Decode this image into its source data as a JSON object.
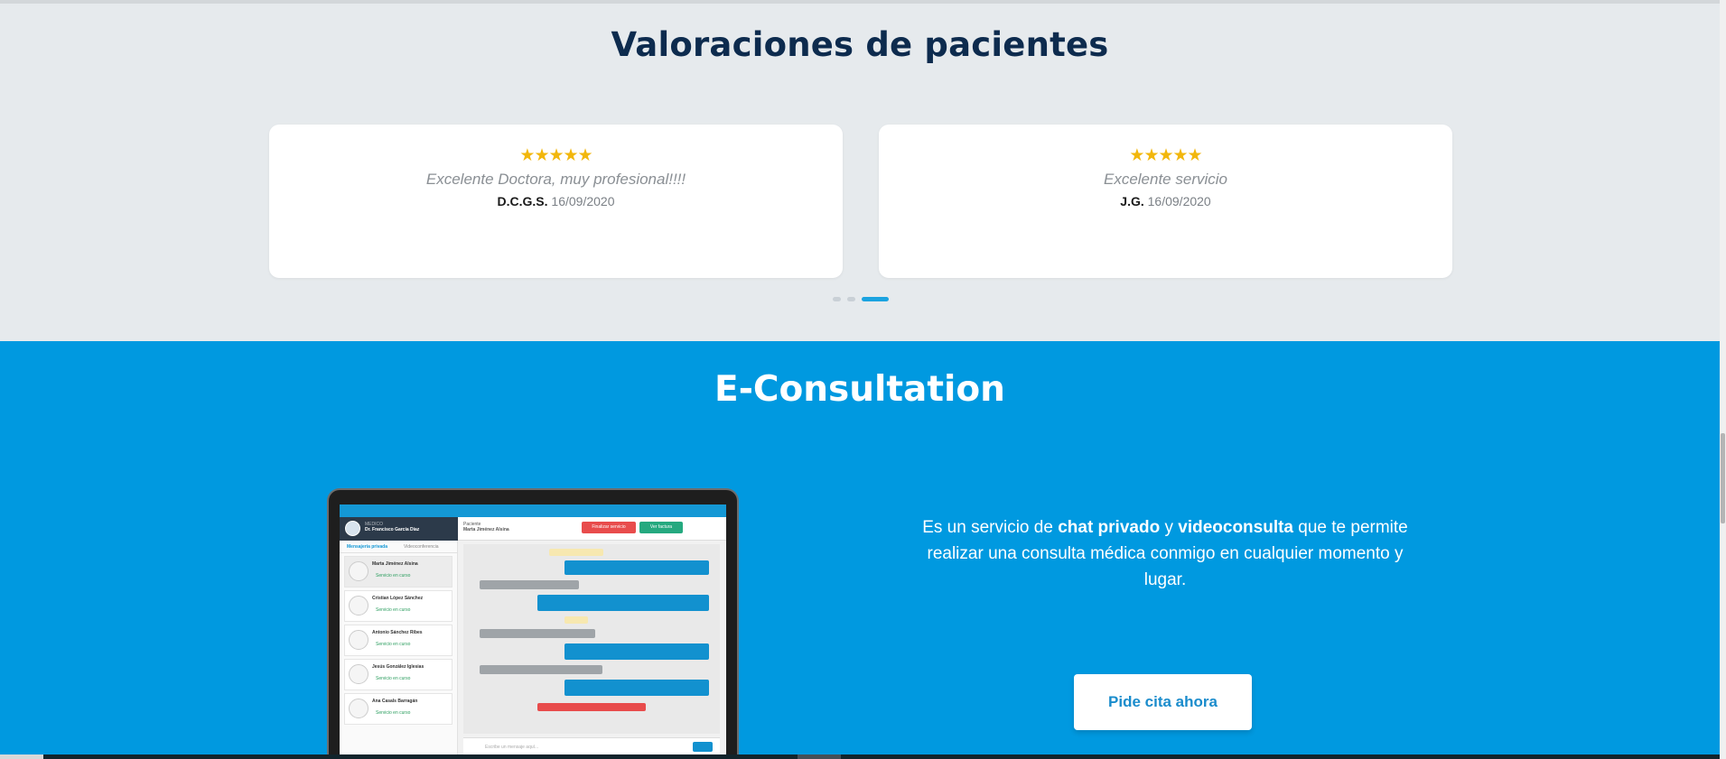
{
  "reviews": {
    "title": "Valoraciones de pacientes",
    "items": [
      {
        "stars": "★★★★★",
        "rating": 5,
        "quote": "Excelente Doctora, muy profesional!!!!",
        "author": "D.C.G.S.",
        "date": "16/09/2020"
      },
      {
        "stars": "★★★★★",
        "rating": 5,
        "quote": "Excelente servicio",
        "author": "J.G.",
        "date": "16/09/2020"
      }
    ],
    "carousel": {
      "total": 3,
      "active": 3
    }
  },
  "econsultation": {
    "title": "E-Consultation",
    "description": {
      "part1": "Es un servicio de ",
      "chat": "chat privado",
      "part2": " y ",
      "video": "videoconsulta",
      "part3": " que te permite realizar una consulta médica conmigo en cualquier momento y lugar."
    },
    "cta_label": "Pide cita ahora",
    "mockup": {
      "doctor_role": "MEDICO",
      "doctor_name": "Dr. Francisco García Díaz",
      "patient_role": "Paciente",
      "patient_name": "Marta Jiménez Alsina",
      "finish_button": "Finalizar servicio",
      "invoice_button": "Ver factura",
      "tab_chat": "Mensajería privada",
      "tab_video": "Videoconferencia",
      "contacts": [
        {
          "name": "Marta Jiménez Alsina",
          "status": "Servicio en curso"
        },
        {
          "name": "Cristian López Sánchez",
          "status": "Servicio en curso"
        },
        {
          "name": "Antonio Sánchez Ribes",
          "status": "Servicio en curso"
        },
        {
          "name": "Jesús González Iglesias",
          "status": "Servicio en curso"
        },
        {
          "name": "Ana Casals Barragán",
          "status": "Servicio en curso"
        }
      ],
      "compose_placeholder": "Escribe un mensaje aquí...",
      "send_label": "Enviar"
    }
  },
  "colors": {
    "reviews_bg": "#e6eaed",
    "title_navy": "#0d2b4e",
    "star_gold": "#f2b70c",
    "econ_blue": "#0099e0",
    "cta_text": "#1a8ccc"
  }
}
